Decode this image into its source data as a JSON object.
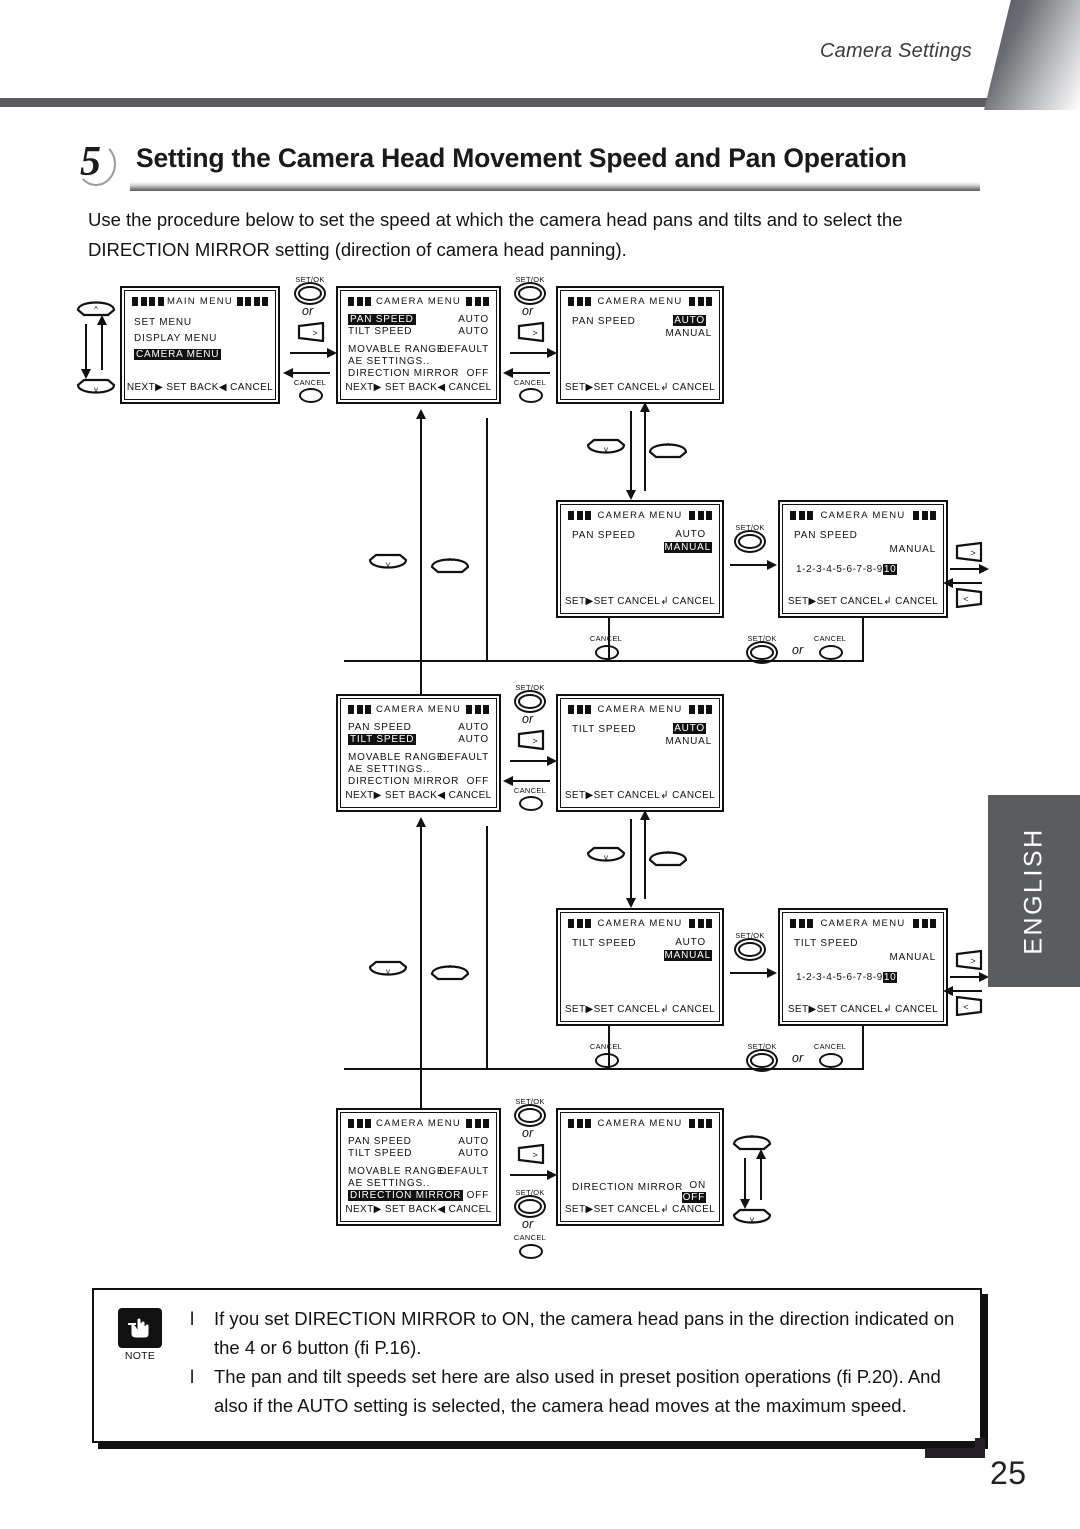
{
  "header": {
    "running_title": "Camera Settings"
  },
  "section": {
    "number": "5",
    "title": "Setting the Camera Head Movement Speed and Pan Operation",
    "intro": "Use the procedure below to set the speed at which the camera head pans and tilts and to select the DIRECTION MIRROR setting (direction of camera head panning)."
  },
  "side_tab": {
    "label": "ENGLISH"
  },
  "controls": {
    "set_ok": "SET/OK",
    "cancel": "CANCEL",
    "or": "or",
    "right_glyph": ">",
    "left_glyph": "<",
    "up_glyph": "^",
    "down_glyph": "v"
  },
  "panels": {
    "main_menu": {
      "title": "MAIN MENU",
      "items": [
        "SET MENU",
        "DISPLAY MENU",
        "CAMERA MENU"
      ],
      "highlighted": "CAMERA MENU",
      "footer": "NEXT▶ SET BACK◀ CANCEL"
    },
    "camera_menu_pan": {
      "title": "CAMERA MENU",
      "rows": [
        {
          "label": "PAN  SPEED",
          "value": "AUTO"
        },
        {
          "label": "TILT SPEED",
          "value": "AUTO"
        },
        {
          "label": "MOVABLE RANGE..",
          "value": "DEFAULT"
        },
        {
          "label": "AE SETTINGS..",
          "value": ""
        },
        {
          "label": "DIRECTION MIRROR",
          "value": "OFF"
        }
      ],
      "highlighted": "PAN  SPEED",
      "footer": "NEXT▶ SET BACK◀ CANCEL"
    },
    "camera_menu_tilt": {
      "title": "CAMERA MENU",
      "rows": [
        {
          "label": "PAN  SPEED",
          "value": "AUTO"
        },
        {
          "label": "TILT SPEED",
          "value": "AUTO"
        },
        {
          "label": "MOVABLE RANGE..",
          "value": "DEFAULT"
        },
        {
          "label": "AE SETTINGS..",
          "value": ""
        },
        {
          "label": "DIRECTION MIRROR",
          "value": "OFF"
        }
      ],
      "highlighted": "TILT SPEED",
      "footer": "NEXT▶ SET BACK◀ CANCEL"
    },
    "camera_menu_mirror": {
      "title": "CAMERA MENU",
      "rows": [
        {
          "label": "PAN  SPEED",
          "value": "AUTO"
        },
        {
          "label": "TILT SPEED",
          "value": "AUTO"
        },
        {
          "label": "MOVABLE RANGE..",
          "value": "DEFAULT"
        },
        {
          "label": "AE SETTINGS..",
          "value": ""
        },
        {
          "label": "DIRECTION MIRROR",
          "value": "OFF"
        }
      ],
      "highlighted": "DIRECTION MIRROR",
      "footer": "NEXT▶ SET BACK◀ CANCEL"
    },
    "pan_speed_auto": {
      "title": "CAMERA MENU",
      "setting": "PAN  SPEED",
      "options": [
        "AUTO",
        "MANUAL"
      ],
      "selected": "AUTO",
      "footer": "SET▶SET CANCEL↲ CANCEL"
    },
    "pan_speed_manual": {
      "title": "CAMERA MENU",
      "setting": "PAN  SPEED",
      "options": [
        "AUTO",
        "MANUAL"
      ],
      "selected": "MANUAL",
      "footer": "SET▶SET CANCEL↲ CANCEL"
    },
    "pan_speed_scale": {
      "title": "CAMERA MENU",
      "setting": "PAN  SPEED",
      "mode": "MANUAL",
      "scale_prefix": "1-2-3-4-5-6-7-8-9",
      "scale_selected": "10",
      "footer": "SET▶SET CANCEL↲ CANCEL"
    },
    "tilt_speed_auto": {
      "title": "CAMERA MENU",
      "setting": "TILT SPEED",
      "options": [
        "AUTO",
        "MANUAL"
      ],
      "selected": "AUTO",
      "footer": "SET▶SET CANCEL↲ CANCEL"
    },
    "tilt_speed_manual": {
      "title": "CAMERA MENU",
      "setting": "TILT SPEED",
      "options": [
        "AUTO",
        "MANUAL"
      ],
      "selected": "MANUAL",
      "footer": "SET▶SET CANCEL↲ CANCEL"
    },
    "tilt_speed_scale": {
      "title": "CAMERA MENU",
      "setting": "TILT SPEED",
      "mode": "MANUAL",
      "scale_prefix": "1-2-3-4-5-6-7-8-9",
      "scale_selected": "10",
      "footer": "SET▶SET CANCEL↲ CANCEL"
    },
    "direction_mirror": {
      "title": "CAMERA MENU",
      "setting": "DIRECTION MIRROR",
      "options": [
        "ON",
        "OFF"
      ],
      "selected": "OFF",
      "footer": "SET▶SET CANCEL↲ CANCEL"
    }
  },
  "note": {
    "label": "NOTE",
    "bullet": "l",
    "items": [
      "If you set DIRECTION MIRROR to ON, the camera head pans in the direction indicated on the 4  or  6  button (fi  P.16).",
      "The pan and tilt speeds set here are also used in preset position operations (fi  P.20). And also if the  AUTO  setting is selected, the camera head moves at the maximum speed."
    ]
  },
  "footer": {
    "page_number": "25"
  }
}
